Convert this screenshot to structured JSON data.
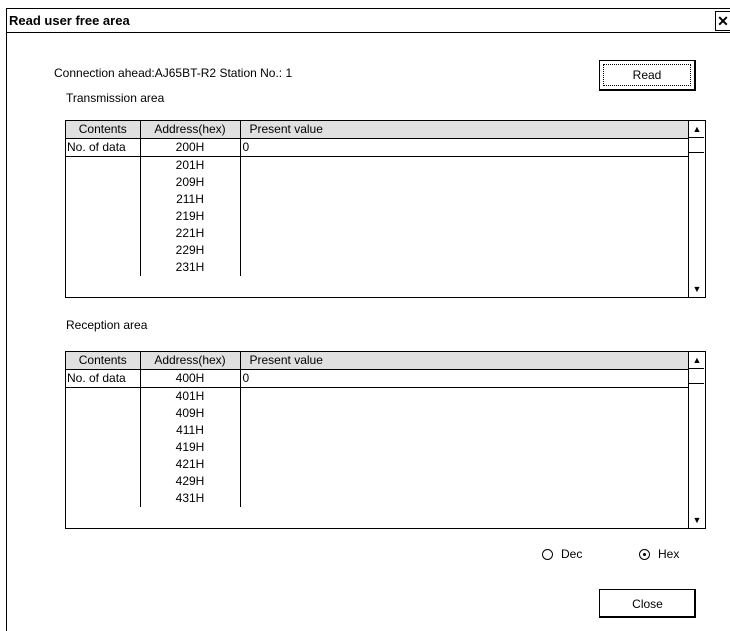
{
  "window": {
    "title": "Read user free area",
    "close_glyph": "✕"
  },
  "connection_label": "Connection ahead:AJ65BT-R2 Station No.:  1",
  "buttons": {
    "read": "Read",
    "close": "Close"
  },
  "transmission": {
    "label": "Transmission area",
    "columns": [
      "Contents",
      "Address(hex)",
      "Present   value"
    ],
    "rows": [
      {
        "contents": "No. of data",
        "address": "200H",
        "value": "0"
      },
      {
        "contents": "",
        "address": "201H",
        "value": ""
      },
      {
        "contents": "",
        "address": "209H",
        "value": ""
      },
      {
        "contents": "",
        "address": "211H",
        "value": ""
      },
      {
        "contents": "",
        "address": "219H",
        "value": ""
      },
      {
        "contents": "",
        "address": "221H",
        "value": ""
      },
      {
        "contents": "",
        "address": "229H",
        "value": ""
      },
      {
        "contents": "",
        "address": "231H",
        "value": ""
      }
    ]
  },
  "reception": {
    "label": "Reception area",
    "columns": [
      "Contents",
      "Address(hex)",
      "Present   value"
    ],
    "rows": [
      {
        "contents": "No. of data",
        "address": "400H",
        "value": "0"
      },
      {
        "contents": "",
        "address": "401H",
        "value": ""
      },
      {
        "contents": "",
        "address": "409H",
        "value": ""
      },
      {
        "contents": "",
        "address": "411H",
        "value": ""
      },
      {
        "contents": "",
        "address": "419H",
        "value": ""
      },
      {
        "contents": "",
        "address": "421H",
        "value": ""
      },
      {
        "contents": "",
        "address": "429H",
        "value": ""
      },
      {
        "contents": "",
        "address": "431H",
        "value": ""
      }
    ]
  },
  "display_format": {
    "options": [
      {
        "label": "Dec",
        "selected": false
      },
      {
        "label": "Hex",
        "selected": true
      }
    ]
  },
  "icons": {
    "scroll_up": "▲",
    "scroll_down": "▼"
  }
}
